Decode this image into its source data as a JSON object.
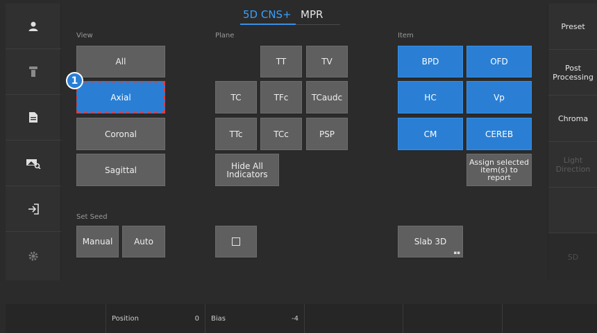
{
  "tabs": {
    "active": "5D CNS+",
    "other": "MPR"
  },
  "sections": {
    "view": "View",
    "plane": "Plane",
    "item": "Item",
    "set_seed": "Set Seed"
  },
  "view_buttons": {
    "all": "All",
    "axial": "Axial",
    "coronal": "Coronal",
    "sagittal": "Sagittal"
  },
  "plane_buttons": {
    "tt": "TT",
    "tv": "TV",
    "tc": "TC",
    "tfc": "TFc",
    "tcaudc": "TCaudc",
    "ttc": "TTc",
    "tcc": "TCc",
    "psp": "PSP",
    "hide_all": "Hide All\nIndicators"
  },
  "item_buttons": {
    "bpd": "BPD",
    "ofd": "OFD",
    "hc": "HC",
    "vp": "Vp",
    "cm": "CM",
    "cereb": "CEREB",
    "assign": "Assign selected\nitem(s) to\nreport"
  },
  "seed_buttons": {
    "manual": "Manual",
    "auto": "Auto"
  },
  "slab_button": "Slab 3D",
  "step_badge": "1",
  "right_rail": {
    "preset": "Preset",
    "post_processing": "Post\nProcessing",
    "chroma": "Chroma",
    "light_direction": "Light\nDirection",
    "sd": "SD"
  },
  "bottom_bar": {
    "position_label": "Position",
    "position_value": "0",
    "bias_label": "Bias",
    "bias_value": "-4"
  },
  "colors": {
    "accent": "#2a7fd4",
    "tab_active": "#3aa0ff",
    "selection_outline": "#e23b3b"
  },
  "icons": {
    "rail": [
      "user-icon",
      "probe-icon",
      "document-icon",
      "image-search-icon",
      "exit-icon",
      "gear-icon"
    ]
  }
}
